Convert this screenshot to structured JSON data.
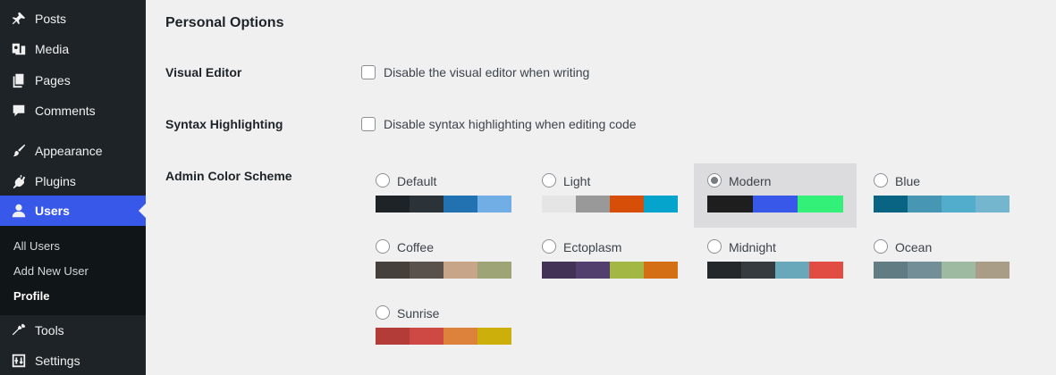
{
  "sidebar": {
    "items": [
      {
        "label": "Posts",
        "icon": "pin-icon"
      },
      {
        "label": "Media",
        "icon": "media-icon"
      },
      {
        "label": "Pages",
        "icon": "pages-icon"
      },
      {
        "label": "Comments",
        "icon": "comment-icon"
      },
      {
        "label": "Appearance",
        "icon": "brush-icon"
      },
      {
        "label": "Plugins",
        "icon": "plug-icon"
      },
      {
        "label": "Users",
        "icon": "user-icon",
        "active": true
      },
      {
        "label": "Tools",
        "icon": "wrench-icon"
      },
      {
        "label": "Settings",
        "icon": "settings-icon"
      }
    ],
    "submenu": [
      "All Users",
      "Add New User",
      "Profile"
    ],
    "current_submenu": "Profile"
  },
  "main": {
    "section_title": "Personal Options",
    "visual_editor": {
      "label": "Visual Editor",
      "checkbox_text": "Disable the visual editor when writing",
      "checked": false
    },
    "syntax": {
      "label": "Syntax Highlighting",
      "checkbox_text": "Disable syntax highlighting when editing code",
      "checked": false
    },
    "color_scheme": {
      "label": "Admin Color Scheme",
      "selected": "Modern",
      "schemes": [
        {
          "name": "Default",
          "colors": [
            "#1d2327",
            "#2c3338",
            "#2271b1",
            "#72aee6"
          ]
        },
        {
          "name": "Light",
          "colors": [
            "#e5e5e5",
            "#999999",
            "#d64e07",
            "#04a4cc"
          ]
        },
        {
          "name": "Modern",
          "colors": [
            "#1e1e1e",
            "#3858e9",
            "#33f078"
          ]
        },
        {
          "name": "Blue",
          "colors": [
            "#096484",
            "#4796b3",
            "#52accc",
            "#74b6ce"
          ]
        },
        {
          "name": "Coffee",
          "colors": [
            "#46403c",
            "#59524c",
            "#c7a589",
            "#9ea476"
          ]
        },
        {
          "name": "Ectoplasm",
          "colors": [
            "#413256",
            "#523f6d",
            "#a3b745",
            "#d46f15"
          ]
        },
        {
          "name": "Midnight",
          "colors": [
            "#25282b",
            "#363b3f",
            "#69a8bb",
            "#e14d43"
          ]
        },
        {
          "name": "Ocean",
          "colors": [
            "#627c83",
            "#738e96",
            "#9ebaa0",
            "#aa9d88"
          ]
        },
        {
          "name": "Sunrise",
          "colors": [
            "#b43c38",
            "#cf4944",
            "#dd823b",
            "#ccaf0b"
          ]
        }
      ]
    }
  }
}
